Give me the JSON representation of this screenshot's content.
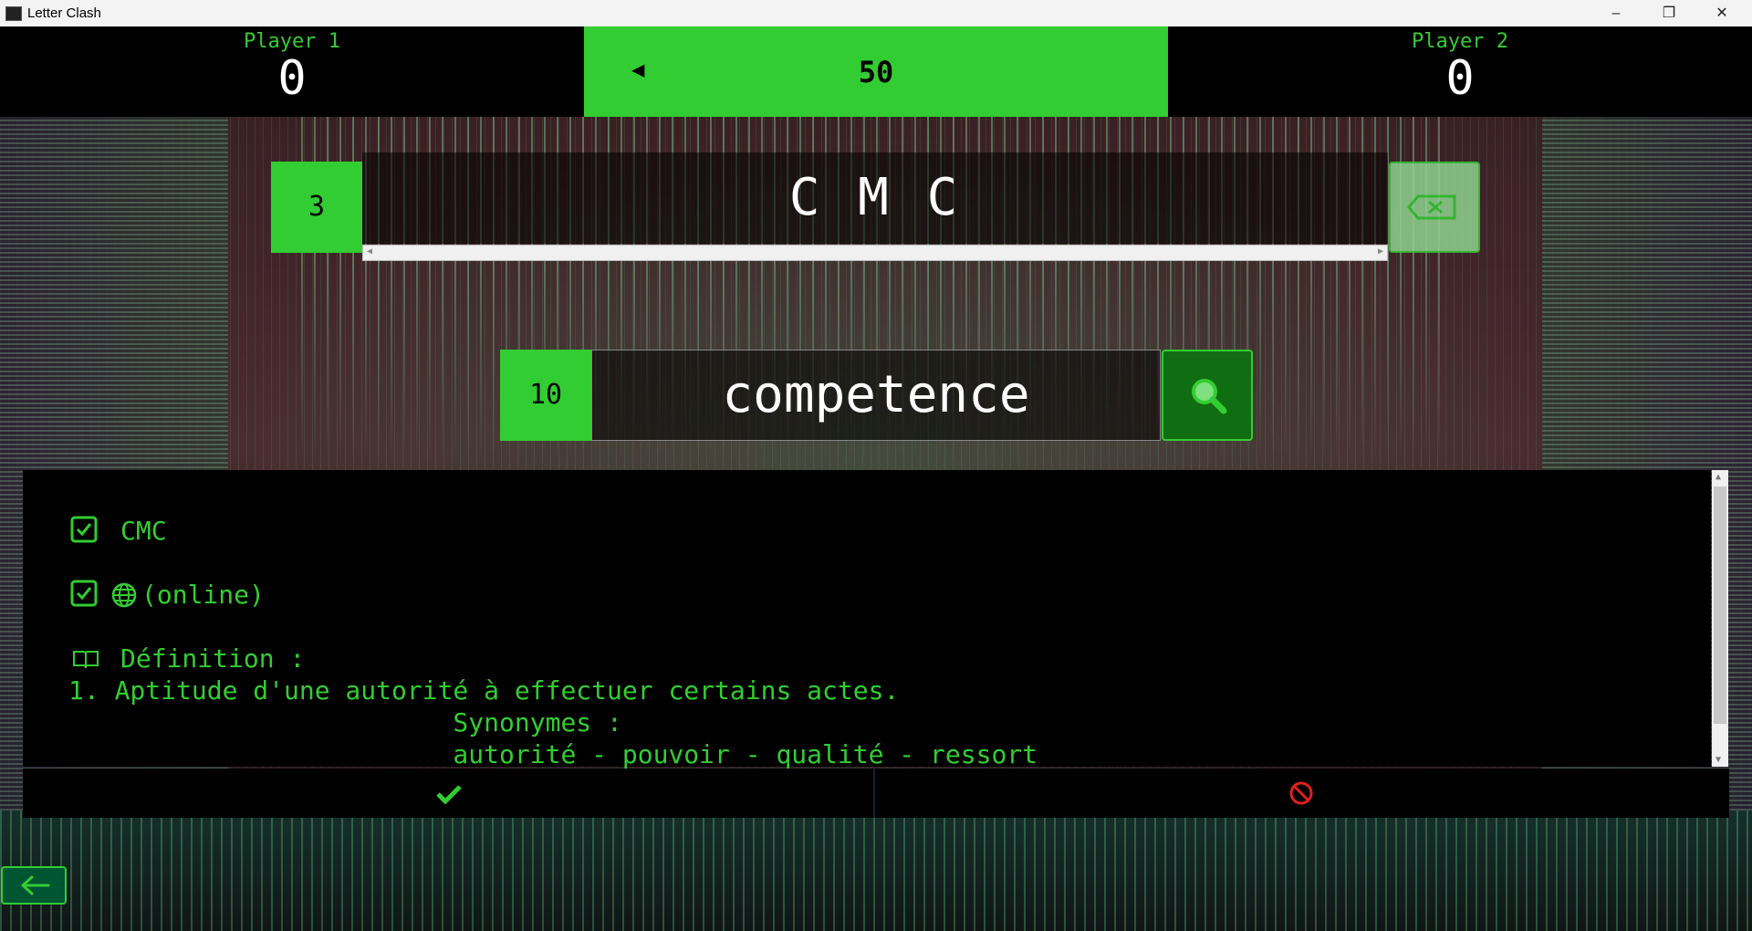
{
  "window": {
    "title": "Letter Clash",
    "controls": {
      "minimize": "–",
      "maximize": "❐",
      "close": "✕"
    }
  },
  "header": {
    "player1": {
      "name": "Player 1",
      "score": "0"
    },
    "player2": {
      "name": "Player 2",
      "score": "0"
    },
    "timer": {
      "arrow": "◀",
      "value": "50"
    }
  },
  "letters": {
    "count": "3",
    "text": "C M C",
    "backspace_icon": "backspace-icon"
  },
  "word": {
    "count": "10",
    "text": "competence",
    "search_icon": "magnifier-icon"
  },
  "results": {
    "letters_check": {
      "checked": true,
      "label": "CMC"
    },
    "online_check": {
      "checked": true,
      "label": "(online)"
    },
    "definition_title": "Définition :",
    "definition_lines": [
      "1. Aptitude d'une autorité à effectuer certains actes.",
      "                         Synonymes :",
      "                         autorité - pouvoir - qualité - ressort"
    ]
  },
  "actions": {
    "accept_icon": "checkmark-icon",
    "reject_icon": "forbidden-icon"
  },
  "colors": {
    "accent": "#32cd32",
    "reject": "#e0201e",
    "panel": "#000000"
  }
}
